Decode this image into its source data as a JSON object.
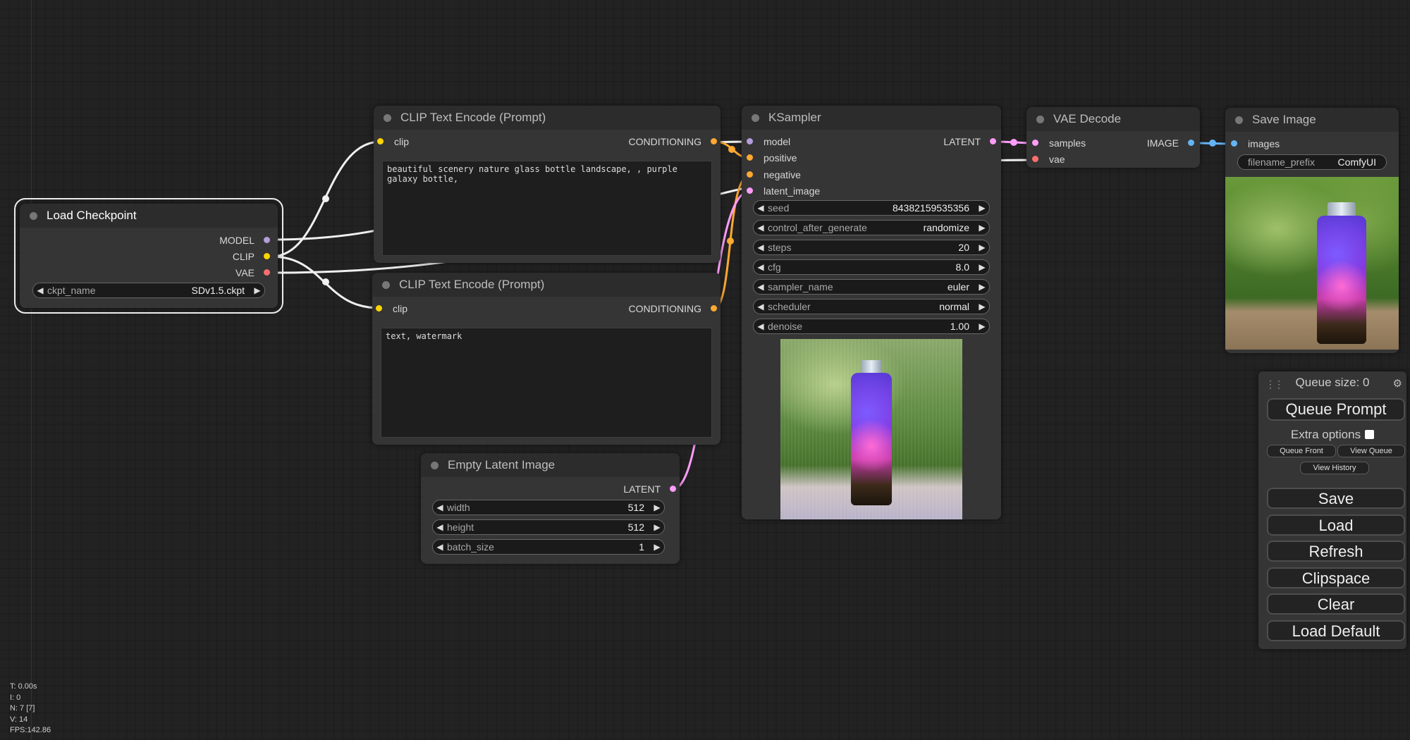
{
  "nodes": {
    "load_checkpoint": {
      "title": "Load Checkpoint",
      "outputs": [
        "MODEL",
        "CLIP",
        "VAE"
      ],
      "widget": {
        "name": "ckpt_name",
        "value": "SDv1.5.ckpt"
      }
    },
    "clip_positive": {
      "title": "CLIP Text Encode (Prompt)",
      "input": "clip",
      "output": "CONDITIONING",
      "text": "beautiful scenery nature glass bottle landscape, , purple galaxy bottle,"
    },
    "clip_negative": {
      "title": "CLIP Text Encode (Prompt)",
      "input": "clip",
      "output": "CONDITIONING",
      "text": "text, watermark"
    },
    "empty_latent": {
      "title": "Empty Latent Image",
      "output": "LATENT",
      "widgets": [
        {
          "name": "width",
          "value": "512"
        },
        {
          "name": "height",
          "value": "512"
        },
        {
          "name": "batch_size",
          "value": "1"
        }
      ]
    },
    "ksampler": {
      "title": "KSampler",
      "inputs": [
        "model",
        "positive",
        "negative",
        "latent_image"
      ],
      "output": "LATENT",
      "widgets": [
        {
          "name": "seed",
          "value": "84382159535356"
        },
        {
          "name": "control_after_generate",
          "value": "randomize"
        },
        {
          "name": "steps",
          "value": "20"
        },
        {
          "name": "cfg",
          "value": "8.0"
        },
        {
          "name": "sampler_name",
          "value": "euler"
        },
        {
          "name": "scheduler",
          "value": "normal"
        },
        {
          "name": "denoise",
          "value": "1.00"
        }
      ]
    },
    "vae_decode": {
      "title": "VAE Decode",
      "inputs": [
        "samples",
        "vae"
      ],
      "output": "IMAGE"
    },
    "save_image": {
      "title": "Save Image",
      "input": "images",
      "widget": {
        "name": "filename_prefix",
        "value": "ComfyUI"
      }
    }
  },
  "menu": {
    "queue_size": "Queue size: 0",
    "queue_prompt": "Queue Prompt",
    "extra_options": "Extra options",
    "queue_front": "Queue Front",
    "view_queue": "View Queue",
    "view_history": "View History",
    "buttons": [
      "Save",
      "Load",
      "Refresh",
      "Clipspace",
      "Clear",
      "Load Default"
    ]
  },
  "stats": [
    "T: 0.00s",
    "I: 0",
    "N: 7 [7]",
    "V: 14",
    "FPS:142.86"
  ],
  "colors": {
    "model": "#b39ddb",
    "clip": "#ffd500",
    "vae": "#ff6e6e",
    "conditioning": "#ffa931",
    "latent": "#ff9cf9",
    "image": "#64b5f6",
    "wire_white": "#f0f0f0"
  },
  "icons": {
    "arrow_left": "◀",
    "arrow_right": "▶",
    "drag_handle": "⋮⋮",
    "gear": "⚙"
  }
}
